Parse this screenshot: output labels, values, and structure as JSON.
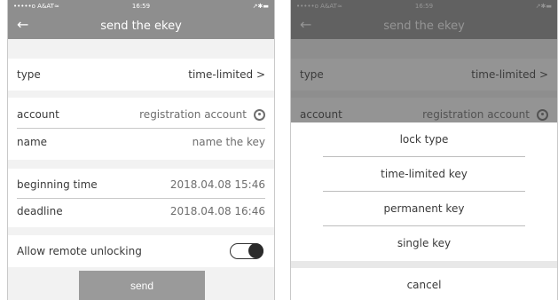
{
  "status_bar": {
    "carrier": "•••••o A&AT",
    "wifi": "≈",
    "time": "16:59",
    "right": "↗✱▬"
  },
  "nav": {
    "back_icon": "←",
    "title": "send the ekey"
  },
  "form": {
    "type_label": "type",
    "type_value": "time-limited",
    "chevron": ">",
    "account_label": "account",
    "account_placeholder": "registration account",
    "name_label": "name",
    "name_placeholder": "name the key",
    "begin_label": "beginning time",
    "begin_value": "2018.04.08 15:46",
    "deadline_label": "deadline",
    "deadline_value": "2018.04.08 16:46",
    "remote_label": "Allow remote unlocking",
    "remote_enabled": true,
    "send_label": "send"
  },
  "sheet": {
    "title": "lock type",
    "options": [
      "time-limited key",
      "permanent key",
      "single key"
    ],
    "cancel": "cancel"
  }
}
